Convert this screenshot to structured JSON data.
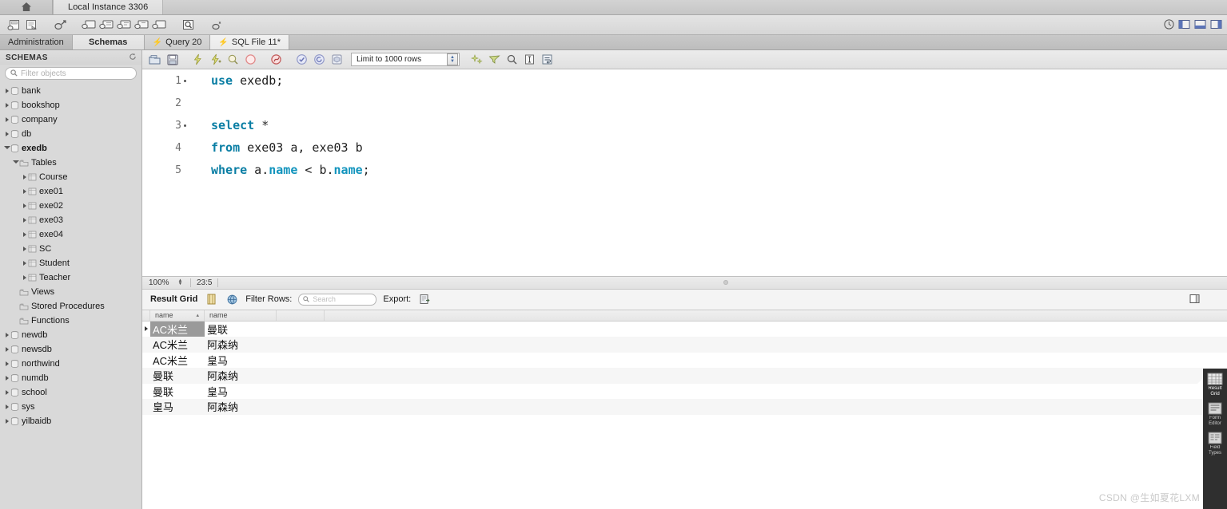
{
  "window": {
    "home_icon": "home-icon",
    "instance_tab": "Local Instance 3306"
  },
  "toolbar": {
    "icons": [
      "new-schema-icon",
      "open-sql-script-icon",
      "open-connection-icon",
      "new-query-tab-icon",
      "new-query-1-icon",
      "new-query-2-icon",
      "new-query-3-icon",
      "new-query-4-icon",
      "inspector-icon",
      "reconnect-icon"
    ],
    "right_icons": [
      "help-icon",
      "toggle-sidebar-icon",
      "toggle-output-icon",
      "toggle-secondary-sidebar-icon"
    ]
  },
  "nav_tabs": [
    {
      "label": "Administration",
      "active": false
    },
    {
      "label": "Schemas",
      "active": true
    },
    {
      "label": "Query 20",
      "active": false,
      "icon": "bolt-icon"
    },
    {
      "label": "SQL File 11*",
      "active": false,
      "icon": "bolt-icon"
    }
  ],
  "sidebar": {
    "header": "SCHEMAS",
    "refresh_icon": "refresh-icon",
    "search": {
      "placeholder": "Filter objects",
      "icon": "search-icon",
      "value": ""
    },
    "tree": [
      {
        "label": "bank",
        "indent": 0,
        "expanded": false,
        "icon": "schema-icon",
        "bold": false
      },
      {
        "label": "bookshop",
        "indent": 0,
        "expanded": false,
        "icon": "schema-icon",
        "bold": false
      },
      {
        "label": "company",
        "indent": 0,
        "expanded": false,
        "icon": "schema-icon",
        "bold": false
      },
      {
        "label": "db",
        "indent": 0,
        "expanded": false,
        "icon": "schema-icon",
        "bold": false
      },
      {
        "label": "exedb",
        "indent": 0,
        "expanded": true,
        "icon": "schema-icon",
        "bold": true
      },
      {
        "label": "Tables",
        "indent": 1,
        "expanded": true,
        "icon": "folder-icon",
        "bold": false
      },
      {
        "label": "Course",
        "indent": 2,
        "expanded": false,
        "icon": "table-icon",
        "bold": false
      },
      {
        "label": "exe01",
        "indent": 2,
        "expanded": false,
        "icon": "table-icon",
        "bold": false
      },
      {
        "label": "exe02",
        "indent": 2,
        "expanded": false,
        "icon": "table-icon",
        "bold": false
      },
      {
        "label": "exe03",
        "indent": 2,
        "expanded": false,
        "icon": "table-icon",
        "bold": false
      },
      {
        "label": "exe04",
        "indent": 2,
        "expanded": false,
        "icon": "table-icon",
        "bold": false
      },
      {
        "label": "SC",
        "indent": 2,
        "expanded": false,
        "icon": "table-icon",
        "bold": false
      },
      {
        "label": "Student",
        "indent": 2,
        "expanded": false,
        "icon": "table-icon",
        "bold": false
      },
      {
        "label": "Teacher",
        "indent": 2,
        "expanded": false,
        "icon": "table-icon",
        "bold": false
      },
      {
        "label": "Views",
        "indent": 1,
        "expanded": null,
        "icon": "folder-icon",
        "bold": false
      },
      {
        "label": "Stored Procedures",
        "indent": 1,
        "expanded": null,
        "icon": "folder-icon",
        "bold": false
      },
      {
        "label": "Functions",
        "indent": 1,
        "expanded": null,
        "icon": "folder-icon",
        "bold": false
      },
      {
        "label": "newdb",
        "indent": 0,
        "expanded": false,
        "icon": "schema-icon",
        "bold": false
      },
      {
        "label": "newsdb",
        "indent": 0,
        "expanded": false,
        "icon": "schema-icon",
        "bold": false
      },
      {
        "label": "northwind",
        "indent": 0,
        "expanded": false,
        "icon": "schema-icon",
        "bold": false
      },
      {
        "label": "numdb",
        "indent": 0,
        "expanded": false,
        "icon": "schema-icon",
        "bold": false
      },
      {
        "label": "school",
        "indent": 0,
        "expanded": false,
        "icon": "schema-icon",
        "bold": false
      },
      {
        "label": "sys",
        "indent": 0,
        "expanded": false,
        "icon": "schema-icon",
        "bold": false
      },
      {
        "label": "yilbaidb",
        "indent": 0,
        "expanded": false,
        "icon": "schema-icon",
        "bold": false
      }
    ]
  },
  "editor": {
    "toolbar_icons": [
      "open-file-icon",
      "save-file-icon",
      "execute-icon",
      "execute-current-icon",
      "explain-icon",
      "stop-icon",
      "stop-on-error-icon",
      "commit-icon",
      "rollback-icon",
      "autocommit-icon"
    ],
    "limit_select": "Limit to 1000 rows",
    "trailing_icons": [
      "beautify-icon",
      "find-icon",
      "search-icon",
      "toggle-invisible-icon",
      "wrap-lines-icon"
    ],
    "lines": [
      {
        "num": "1",
        "marker": true,
        "tokens": [
          {
            "t": "use",
            "c": "kw"
          },
          {
            "t": " exedb;",
            "c": "id"
          }
        ]
      },
      {
        "num": "2",
        "marker": false,
        "tokens": []
      },
      {
        "num": "3",
        "marker": true,
        "tokens": [
          {
            "t": "select",
            "c": "kw"
          },
          {
            "t": " *",
            "c": "op"
          }
        ]
      },
      {
        "num": "4",
        "marker": false,
        "tokens": [
          {
            "t": "from",
            "c": "kw"
          },
          {
            "t": " exe03 a, exe03 b",
            "c": "id"
          }
        ]
      },
      {
        "num": "5",
        "marker": false,
        "tokens": [
          {
            "t": "where",
            "c": "kw"
          },
          {
            "t": " a.",
            "c": "id"
          },
          {
            "t": "name",
            "c": "kw2"
          },
          {
            "t": " < b.",
            "c": "id"
          },
          {
            "t": "name",
            "c": "kw2"
          },
          {
            "t": ";",
            "c": "id"
          }
        ]
      }
    ]
  },
  "status": {
    "zoom": "100%",
    "cursor_position": "23:5"
  },
  "results": {
    "tab_label": "Result Grid",
    "grid_icon": "grid-icon",
    "globe_icon": "globe-icon",
    "filter_label": "Filter Rows:",
    "filter_placeholder": "Search",
    "filter_value": "",
    "export_label": "Export:",
    "export_icon": "export-icon",
    "panel_toggle_icon": "toggle-panel-icon",
    "columns": [
      "name",
      "name"
    ],
    "sort_indicator": "▴",
    "rows": [
      {
        "name_a": "AC米兰",
        "name_b": "曼联",
        "selected": true,
        "current": true
      },
      {
        "name_a": "AC米兰",
        "name_b": "阿森纳",
        "selected": false,
        "current": false
      },
      {
        "name_a": "AC米兰",
        "name_b": "皇马",
        "selected": false,
        "current": false
      },
      {
        "name_a": "曼联",
        "name_b": "阿森纳",
        "selected": false,
        "current": false
      },
      {
        "name_a": "曼联",
        "name_b": "皇马",
        "selected": false,
        "current": false
      },
      {
        "name_a": "皇马",
        "name_b": "阿森纳",
        "selected": false,
        "current": false
      }
    ]
  },
  "right_rail": [
    {
      "label": "Result Grid",
      "icon": "result-grid-icon",
      "active": true
    },
    {
      "label": "Form Editor",
      "icon": "form-editor-icon",
      "active": false
    },
    {
      "label": "Field Types",
      "icon": "field-types-icon",
      "active": false
    }
  ],
  "watermark": "CSDN @生如夏花LXM"
}
